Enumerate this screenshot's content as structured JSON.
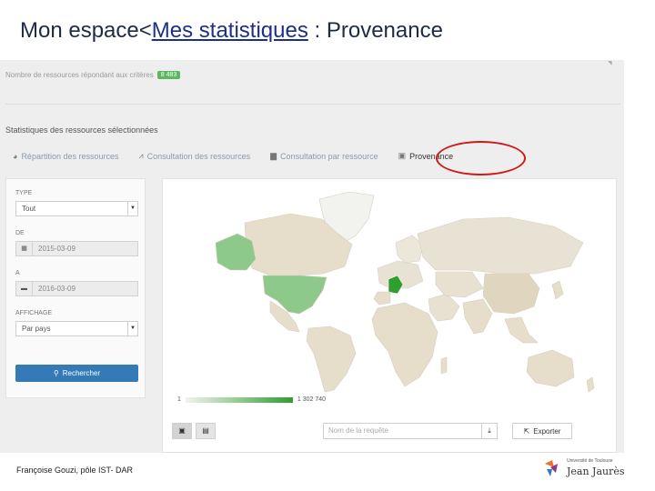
{
  "slide": {
    "title_prefix": "Mon espace<",
    "title_link": "Mes statistiques",
    "title_suffix": "  : Provenance",
    "footer": "Françoise Gouzi, pôle IST- DAR",
    "logo_small": "Université de Toulouse",
    "logo_big": "Jean Jaurès"
  },
  "app": {
    "resource_count_label": "Nombre de ressources répondant aux critères",
    "resource_count": "8 483",
    "panel_title": "Statistiques des ressources sélectionnées",
    "tabs": [
      {
        "label": "Répartition des ressources",
        "icon": "pie-chart-icon"
      },
      {
        "label": "Consultation des ressources",
        "icon": "line-chart-icon"
      },
      {
        "label": "Consultation par ressource",
        "icon": "bar-chart-icon"
      },
      {
        "label": "Provenance",
        "icon": "map-icon"
      }
    ],
    "active_tab": "Provenance",
    "filters": {
      "type_label": "TYPE",
      "type_value": "Tout",
      "from_label": "DE",
      "from_value": "2015-03-09",
      "to_label": "A",
      "to_value": "2016-03-09",
      "display_label": "AFFICHAGE",
      "display_value": "Par pays",
      "search_button": "Rechercher"
    },
    "legend": {
      "min": "1",
      "max": "1 302 740"
    },
    "query_placeholder": "Nom de la requête",
    "export_button": "Exporter",
    "colors": {
      "accent": "#337ab7",
      "highlight_ring": "#d01818",
      "map_high": "#2e9e2e",
      "map_base": "#e8e0d0"
    }
  }
}
